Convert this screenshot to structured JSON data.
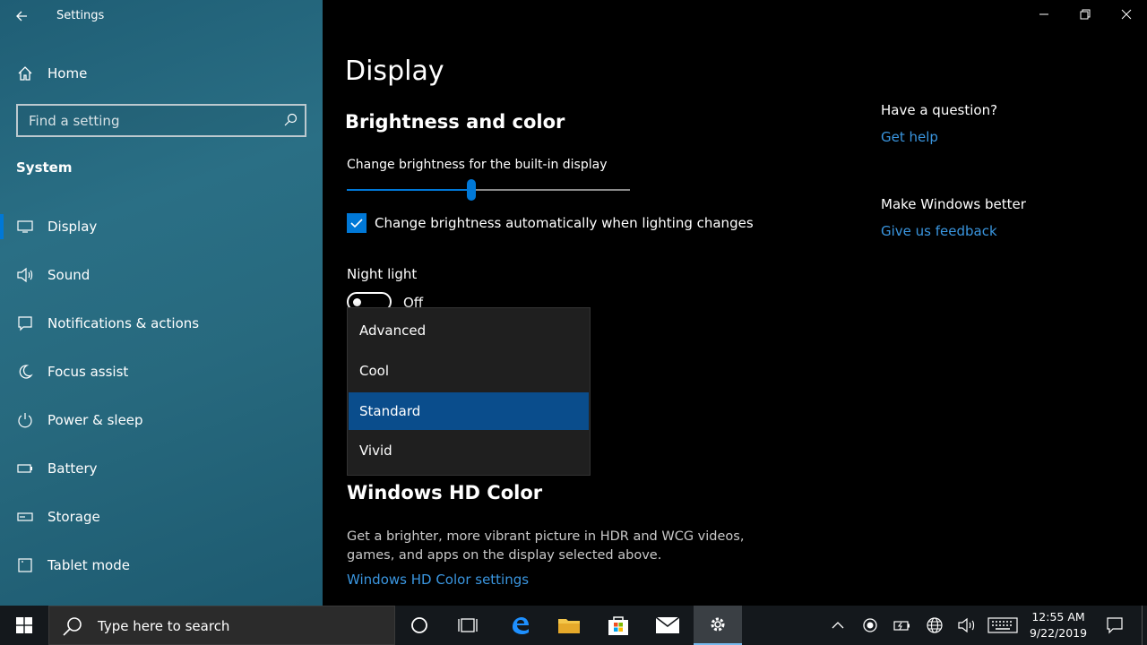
{
  "window": {
    "app_title": "Settings",
    "controls": {
      "minimize": "—",
      "restore": "❐",
      "close": "✕"
    }
  },
  "sidebar": {
    "home_label": "Home",
    "search_placeholder": "Find a setting",
    "section_label": "System",
    "items": [
      {
        "label": "Display",
        "icon": "monitor-icon",
        "active": true
      },
      {
        "label": "Sound",
        "icon": "speaker-icon"
      },
      {
        "label": "Notifications & actions",
        "icon": "message-icon"
      },
      {
        "label": "Focus assist",
        "icon": "moon-icon"
      },
      {
        "label": "Power & sleep",
        "icon": "power-icon"
      },
      {
        "label": "Battery",
        "icon": "battery-icon"
      },
      {
        "label": "Storage",
        "icon": "storage-icon"
      },
      {
        "label": "Tablet mode",
        "icon": "tablet-icon"
      }
    ]
  },
  "main": {
    "page_title": "Display",
    "section_title": "Brightness and color",
    "brightness_label": "Change brightness for the built-in display",
    "brightness_value": 0.44,
    "auto_brightness_label": "Change brightness automatically when lighting changes",
    "auto_brightness_checked": true,
    "night_light_label": "Night light",
    "night_light_state": "Off",
    "dropdown": {
      "options": [
        "Advanced",
        "Cool",
        "Standard",
        "Vivid"
      ],
      "selected": "Standard"
    },
    "hdr_title": "Windows HD Color",
    "hdr_description": "Get a brighter, more vibrant picture in HDR and WCG videos, games, and apps on the display selected above.",
    "hdr_link": "Windows HD Color settings"
  },
  "aside": {
    "question": "Have a question?",
    "help_link": "Get help",
    "better": "Make Windows better",
    "feedback_link": "Give us feedback"
  },
  "taskbar": {
    "search_placeholder": "Type here to search",
    "time": "12:55 AM",
    "date": "9/22/2019"
  },
  "colors": {
    "accent": "#0078d7",
    "link": "#3a96e0",
    "selected_option": "#0a4d8c"
  }
}
